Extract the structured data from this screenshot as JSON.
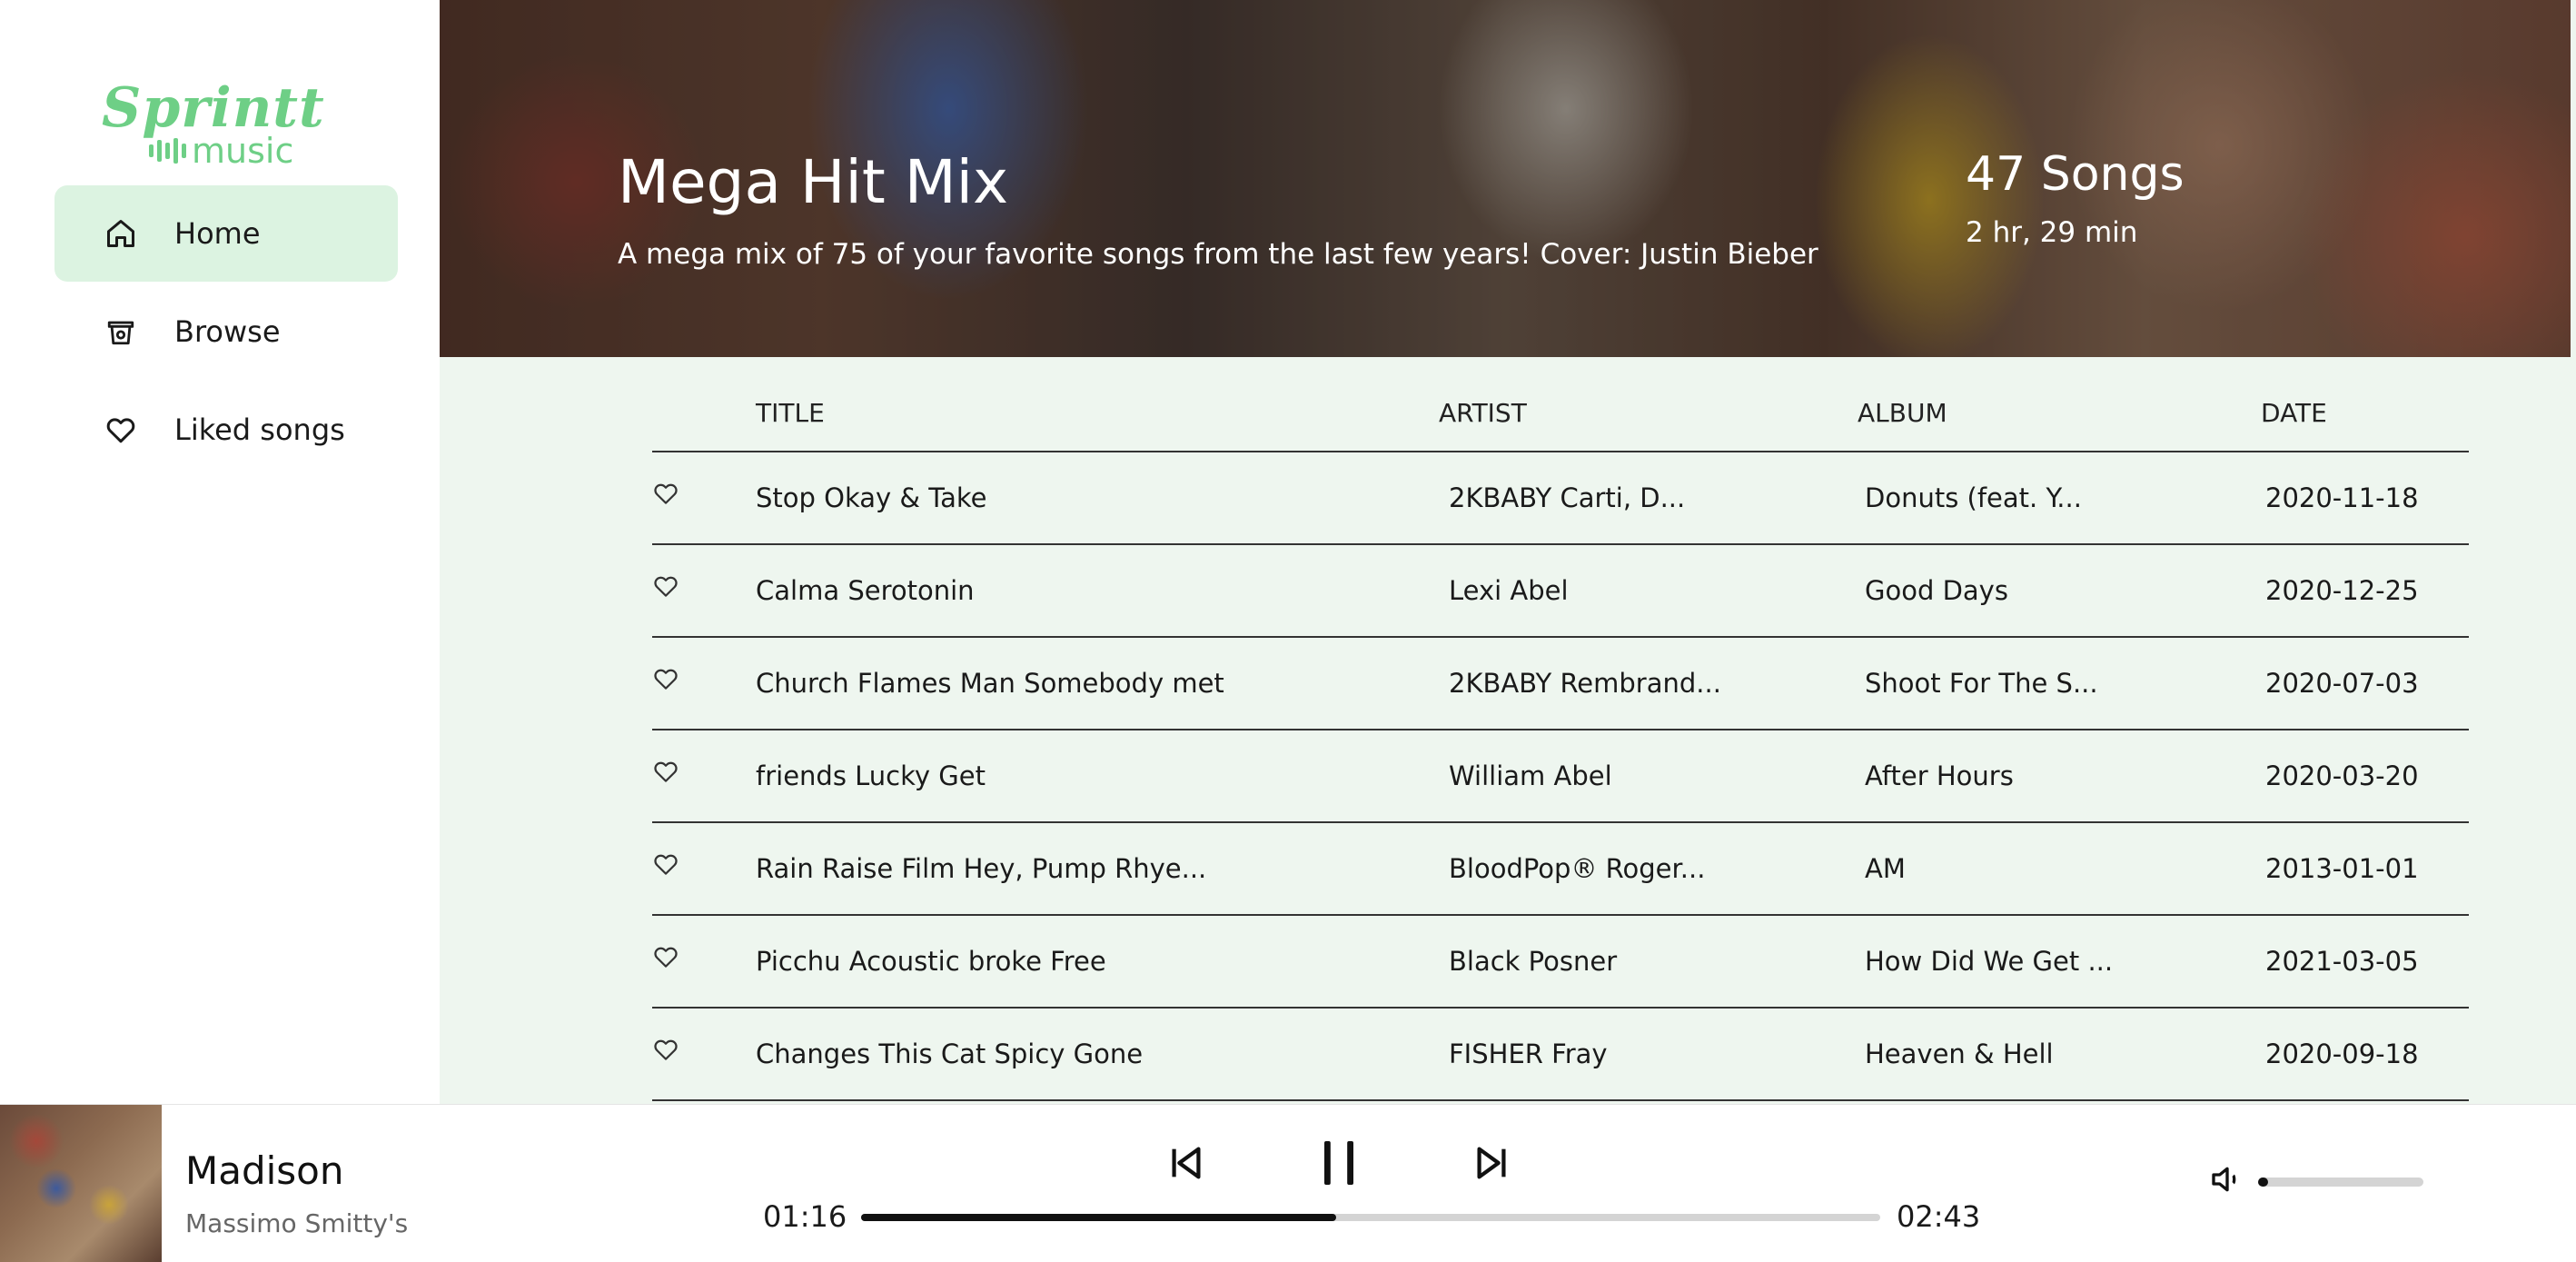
{
  "app": {
    "logo_top": "Sprintt",
    "logo_bottom": "music",
    "brand_color": "#6ecf86"
  },
  "sidebar": {
    "items": [
      {
        "label": "Home",
        "icon": "home-icon",
        "active": true
      },
      {
        "label": "Browse",
        "icon": "browse-icon",
        "active": false
      },
      {
        "label": "Liked songs",
        "icon": "heart-icon",
        "active": false
      }
    ]
  },
  "playlist": {
    "title": "Mega Hit Mix",
    "description": "A mega mix of 75 of your favorite songs from the last few years! Cover: Justin Bieber",
    "song_count": "47 Songs",
    "duration": "2 hr, 29 min"
  },
  "table": {
    "headers": {
      "title": "TITLE",
      "artist": "ARTIST",
      "album": "ALBUM",
      "date": "DATE"
    },
    "rows": [
      {
        "title": "Stop Okay & Take",
        "artist": "2KBABY Carti, D...",
        "album": "Donuts (feat. Y...",
        "date": "2020-11-18"
      },
      {
        "title": "Calma Serotonin",
        "artist": "Lexi Abel",
        "album": "Good Days",
        "date": "2020-12-25"
      },
      {
        "title": "Church Flames Man Somebody met",
        "artist": "2KBABY Rembrand...",
        "album": "Shoot For The S...",
        "date": "2020-07-03"
      },
      {
        "title": "friends Lucky Get",
        "artist": "William Abel",
        "album": "After Hours",
        "date": "2020-03-20"
      },
      {
        "title": "Rain Raise Film Hey, Pump Rhye...",
        "artist": "BloodPop® Roger...",
        "album": "AM",
        "date": "2013-01-01"
      },
      {
        "title": "Picchu Acoustic broke Free",
        "artist": "Black Posner",
        "album": "How Did We Get ...",
        "date": "2021-03-05"
      },
      {
        "title": "Changes This Cat Spicy Gone",
        "artist": "FISHER Fray",
        "album": "Heaven & Hell",
        "date": "2020-09-18"
      }
    ]
  },
  "player": {
    "track_title": "Madison",
    "track_artist": "Massimo Smitty's",
    "current_time": "01:16",
    "total_time": "02:43",
    "progress_fraction": 0.466,
    "volume_fraction": 0.06,
    "controls": [
      "skip-back-icon",
      "pause-icon",
      "skip-forward-icon"
    ]
  }
}
